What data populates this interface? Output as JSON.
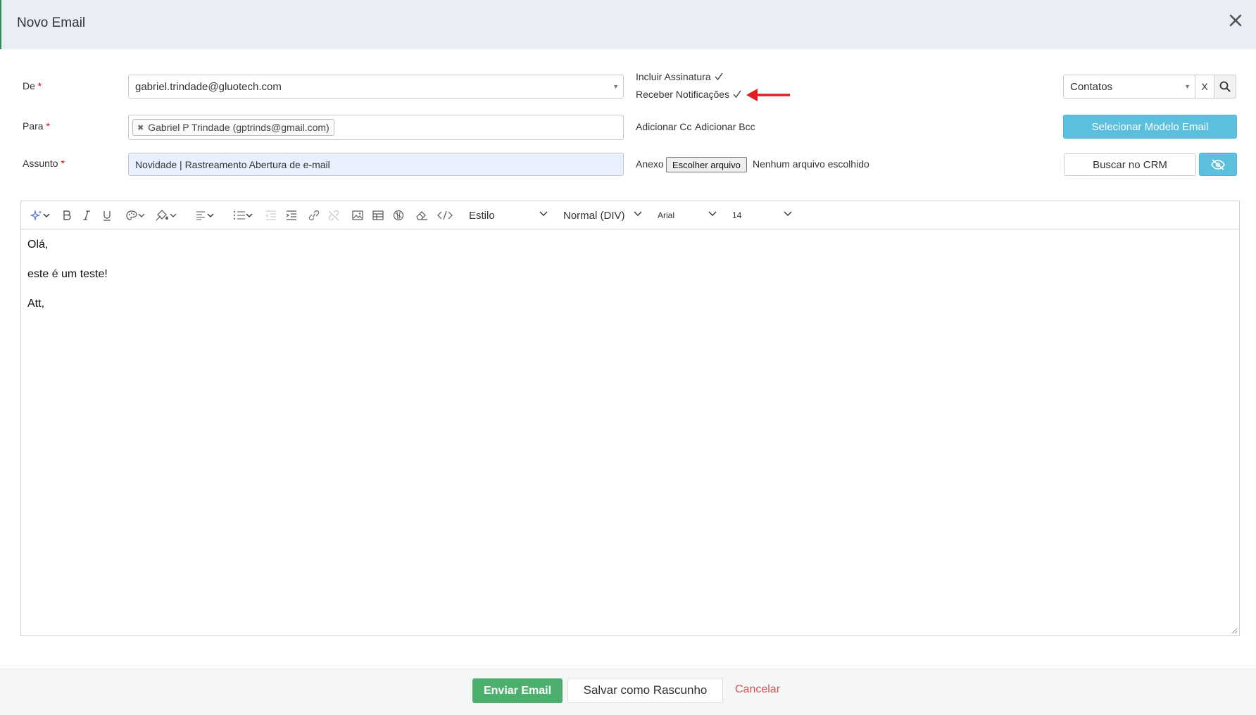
{
  "window": {
    "title": "Novo Email"
  },
  "form": {
    "from_label": "De",
    "from_value": "gabriel.trindade@gluotech.com",
    "to_label": "Para",
    "to_chip": "Gabriel P Trindade (gptrinds@gmail.com)",
    "subject_label": "Assunto",
    "subject_value": "Novidade | Rastreamento Abertura de e-mail",
    "required_mark": "*"
  },
  "options": {
    "include_signature": "Incluir Assinatura",
    "receive_notifications": "Receber Notificações",
    "add_cc": "Adicionar Cc",
    "add_bcc": "Adicionar Bcc",
    "attachment_label": "Anexo",
    "choose_file": "Escolher arquivo",
    "no_file": "Nenhum arquivo escolhido"
  },
  "sidebar": {
    "contacts_select": "Contatos",
    "clear_label": "X",
    "template_button": "Selecionar Modelo Email",
    "crm_button": "Buscar no CRM"
  },
  "toolbar": {
    "style_select": "Estilo",
    "format_select": "Normal (DIV)",
    "font_select": "Arial",
    "size_select": "14"
  },
  "body": {
    "lines": [
      "Olá,",
      "este é um teste!",
      "Att,"
    ]
  },
  "footer": {
    "send_button": "Enviar Email",
    "draft_button": "Salvar como Rascunho",
    "cancel_link": "Cancelar"
  },
  "colors": {
    "header_bg": "#e9eef6",
    "accent_blue": "#5bc0de",
    "send_green": "#4caf6e",
    "cancel_red": "#d9534f",
    "required_red": "#d0021b",
    "annotation_arrow": "#e02020"
  }
}
